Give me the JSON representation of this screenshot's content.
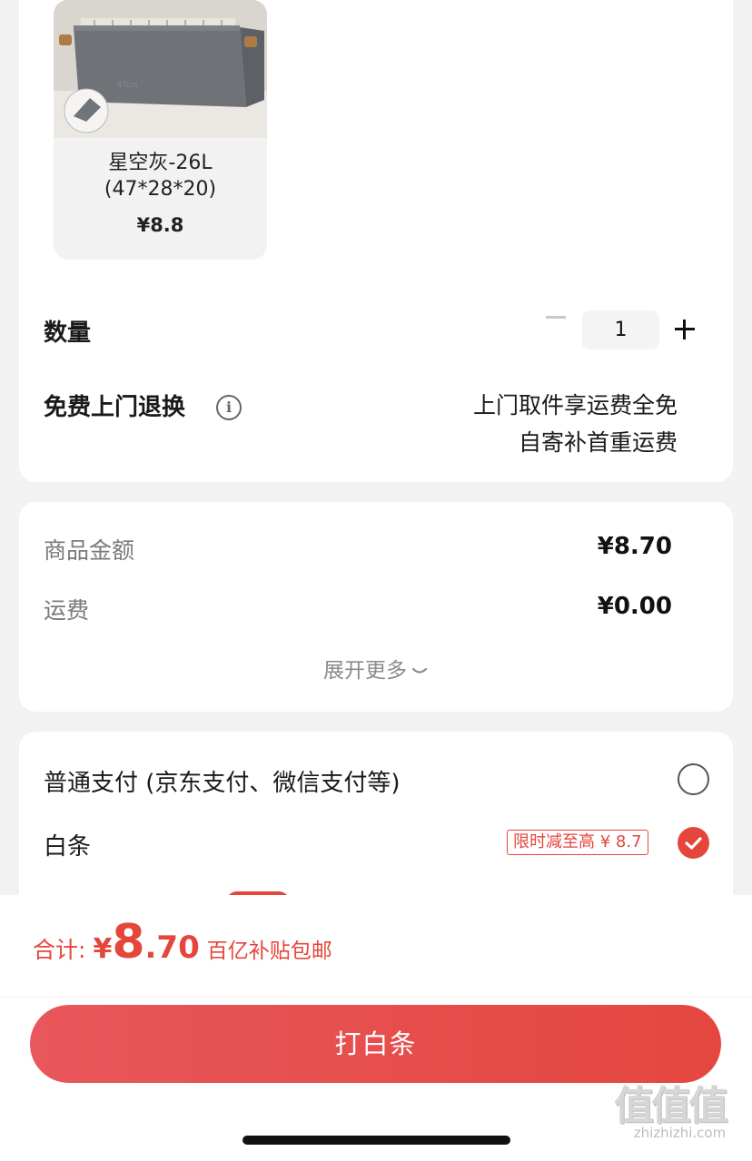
{
  "product": {
    "sku_name_line1": "星空灰-26L",
    "sku_name_line2": "(47*28*20)",
    "sku_price": "¥8.8"
  },
  "quantity": {
    "label": "数量",
    "value": "1"
  },
  "return_service": {
    "label": "免费上门退换",
    "info_icon": "i",
    "note_line1": "上门取件享运费全免",
    "note_line2": "自寄补首重运费"
  },
  "summary": {
    "rows": [
      {
        "label": "商品金额",
        "value": "¥8.70"
      },
      {
        "label": "运费",
        "value": "¥0.00"
      }
    ],
    "expand_label": "展开更多"
  },
  "payment": {
    "options": [
      {
        "label": "普通支付 (京东支付、微信支付等)",
        "selected": false
      },
      {
        "label": "白条",
        "selected": true,
        "badge": "限时减至高 ¥ 8.7"
      }
    ]
  },
  "footer": {
    "total_label": "合计:",
    "total_currency": "¥",
    "total_int": "8",
    "total_dec": ".70",
    "total_note": "百亿补贴包邮",
    "pay_button": "打白条",
    "watermark_glyphs": "值值值",
    "watermark_url": "zhizhizhi.com"
  },
  "colors": {
    "accent": "#e5463b",
    "background": "#f2f2f2"
  },
  "icons": [
    "info-icon",
    "minus-icon",
    "plus-icon",
    "chevron-down-icon",
    "radio-empty-icon",
    "check-icon"
  ]
}
